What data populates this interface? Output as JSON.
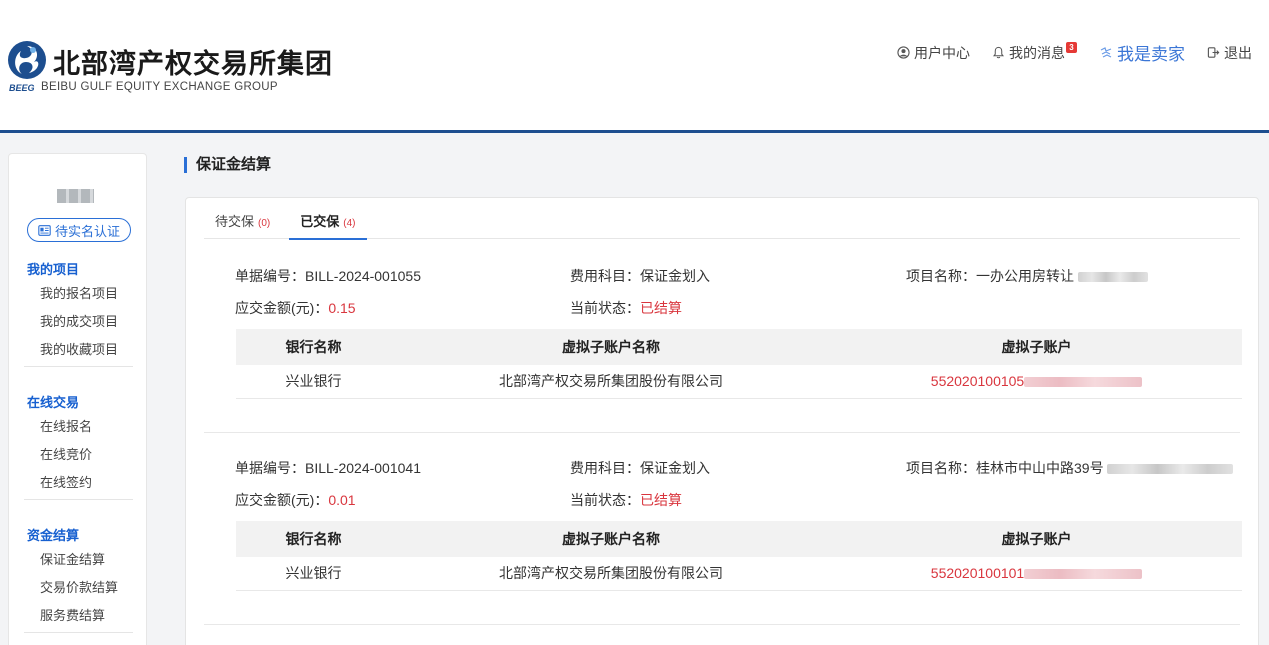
{
  "brand": {
    "name_cn": "北部湾产权交易所集团",
    "abbr": "BEEG",
    "name_en": "BEIBU GULF EQUITY EXCHANGE GROUP",
    "color": "#1d4e8f"
  },
  "topnav": {
    "user_center": "用户中心",
    "messages": "我的消息",
    "message_count": "3",
    "seller": "我是卖家",
    "logout": "退出"
  },
  "sidebar": {
    "verify_button": "待实名认证",
    "groups": [
      {
        "title": "我的项目",
        "items": [
          "我的报名项目",
          "我的成交项目",
          "我的收藏项目"
        ]
      },
      {
        "title": "在线交易",
        "items": [
          "在线报名",
          "在线竞价",
          "在线签约"
        ]
      },
      {
        "title": "资金结算",
        "items": [
          "保证金结算",
          "交易价款结算",
          "服务费结算"
        ]
      }
    ]
  },
  "page": {
    "title": "保证金结算",
    "tabs": [
      {
        "label": "待交保",
        "count": "(0)"
      },
      {
        "label": "已交保",
        "count": "(4)"
      }
    ]
  },
  "labels": {
    "bill_no": "单据编号：",
    "fee_subject": "费用科目：",
    "project_name": "项目名称：",
    "amount": "应交金额(元)：",
    "status": "当前状态：",
    "col_bank": "银行名称",
    "col_account_name": "虚拟子账户名称",
    "col_account": "虚拟子账户"
  },
  "records": [
    {
      "bill_no": "BILL-2024-001055",
      "fee_subject": "保证金划入",
      "project_name": "一办公用房转让",
      "amount": "0.15",
      "status": "已结算",
      "bank": "兴业银行",
      "account_name": "北部湾产权交易所集团股份有限公司",
      "account": "552020100105"
    },
    {
      "bill_no": "BILL-2024-001041",
      "fee_subject": "保证金划入",
      "project_name": "桂林市中山中路39号",
      "amount": "0.01",
      "status": "已结算",
      "bank": "兴业银行",
      "account_name": "北部湾产权交易所集团股份有限公司",
      "account": "552020100101"
    }
  ],
  "colors": {
    "accent": "#2a6fd6",
    "danger": "#d9363e",
    "seller": "#3b76d6"
  }
}
